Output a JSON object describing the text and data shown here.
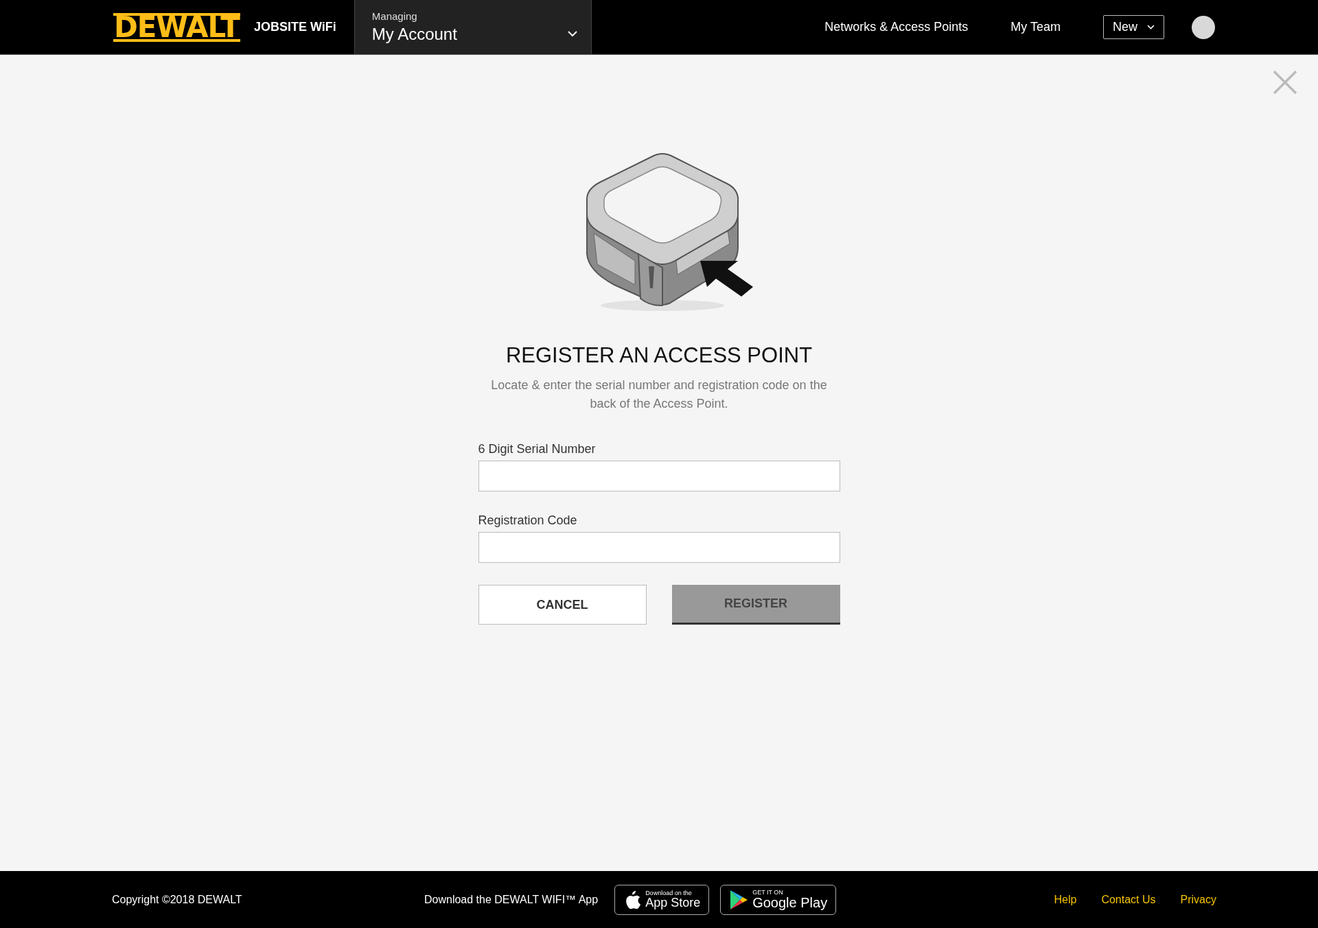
{
  "header": {
    "logo": "DEWALT",
    "product": "JOBSITE WiFi",
    "account_switcher": {
      "caption": "Managing",
      "value": "My Account"
    },
    "nav": [
      {
        "label": "Networks & Access Points"
      },
      {
        "label": "My Team"
      }
    ],
    "new_button": "New"
  },
  "dialog": {
    "title": "REGISTER AN ACCESS POINT",
    "description": "Locate & enter the serial number and registration code on the back of the Access Point.",
    "fields": [
      {
        "label": "6 Digit Serial Number"
      },
      {
        "label": "Registration Code"
      }
    ],
    "buttons": [
      {
        "label": "CANCEL",
        "kind": "secondary",
        "disabled": false
      },
      {
        "label": "REGISTER",
        "kind": "primary",
        "disabled": true
      }
    ]
  },
  "footer": {
    "copyright": "Copyright ©2018 DEWALT",
    "download_text": "Download the DEWALT WIFI™ App",
    "badges": [
      {
        "kind": "apple",
        "small": "Download on the",
        "big": "App Store"
      },
      {
        "kind": "google",
        "small": "GET IT ON",
        "big": "Google Play"
      }
    ],
    "links": [
      {
        "label": "Help"
      },
      {
        "label": "Contact Us"
      },
      {
        "label": "Privacy"
      }
    ]
  }
}
